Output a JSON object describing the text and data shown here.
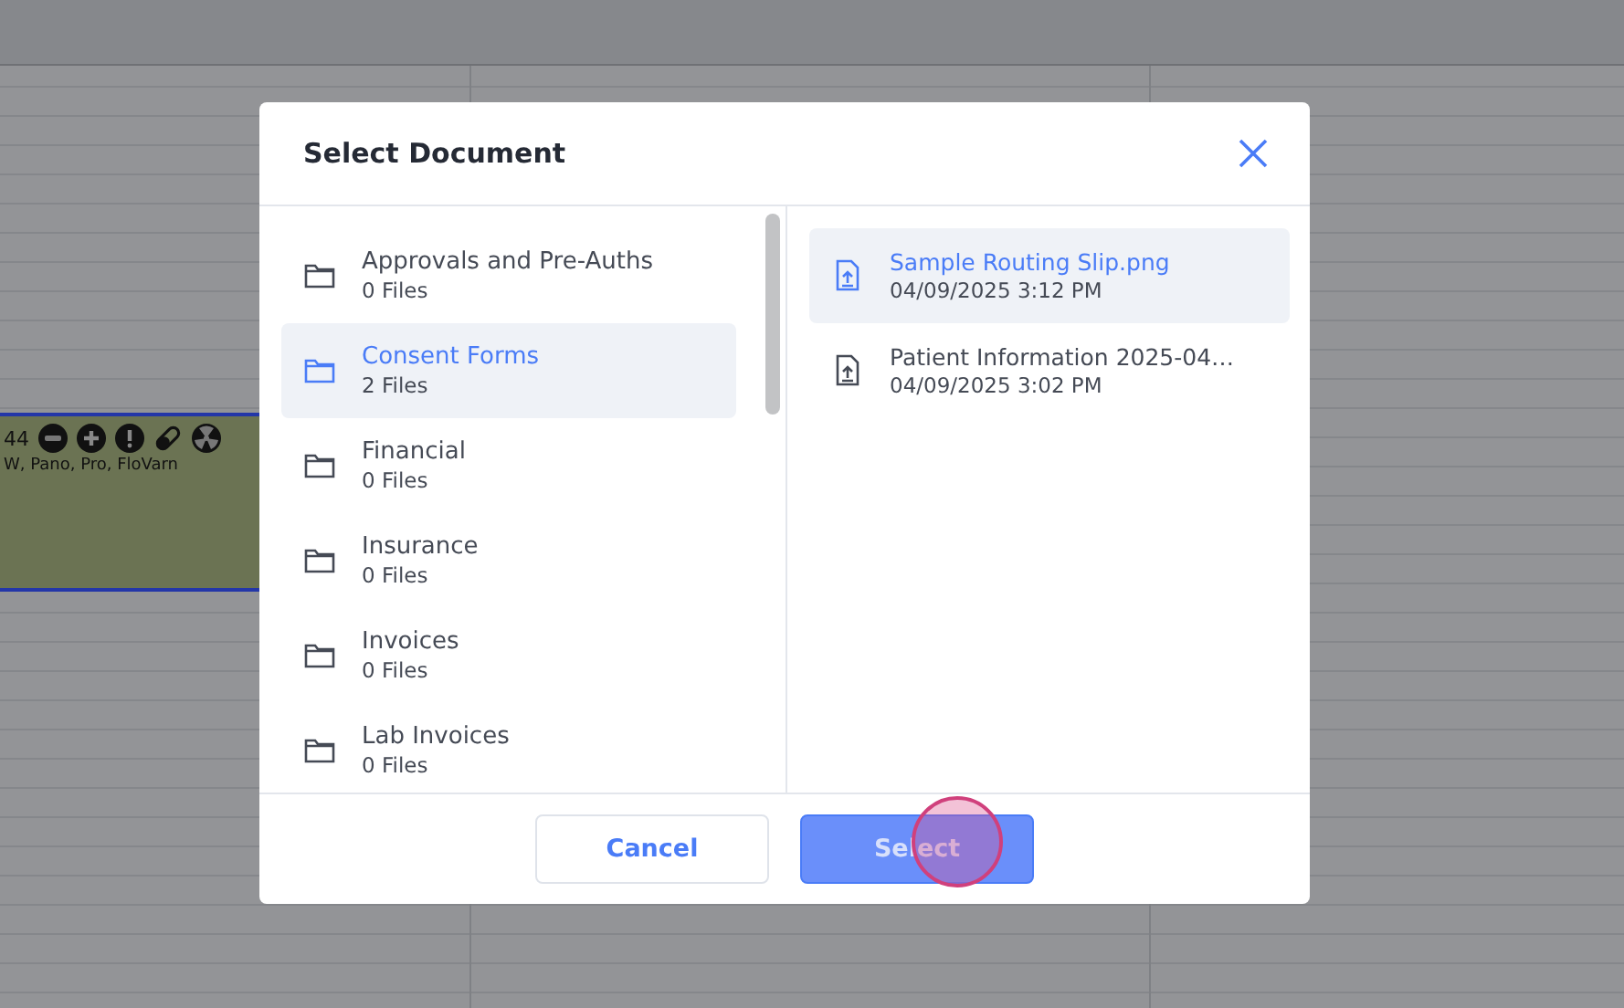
{
  "calendar": {
    "appointment": {
      "time": "44",
      "procedures": "W, Pano, Pro, FloVarn"
    }
  },
  "dialog": {
    "title": "Select Document",
    "folders": [
      {
        "name": "Approvals and Pre-Auths",
        "count": "0 Files",
        "selected": false
      },
      {
        "name": "Consent Forms",
        "count": "2 Files",
        "selected": true
      },
      {
        "name": "Financial",
        "count": "0 Files",
        "selected": false
      },
      {
        "name": "Insurance",
        "count": "0 Files",
        "selected": false
      },
      {
        "name": "Invoices",
        "count": "0 Files",
        "selected": false
      },
      {
        "name": "Lab Invoices",
        "count": "0 Files",
        "selected": false
      }
    ],
    "files": [
      {
        "name": "Sample Routing Slip.png",
        "date": "04/09/2025 3:12 PM",
        "selected": true
      },
      {
        "name": "Patient Information 2025-04…",
        "date": "04/09/2025 3:02 PM",
        "selected": false
      }
    ],
    "buttons": {
      "cancel": "Cancel",
      "select": "Select"
    }
  }
}
